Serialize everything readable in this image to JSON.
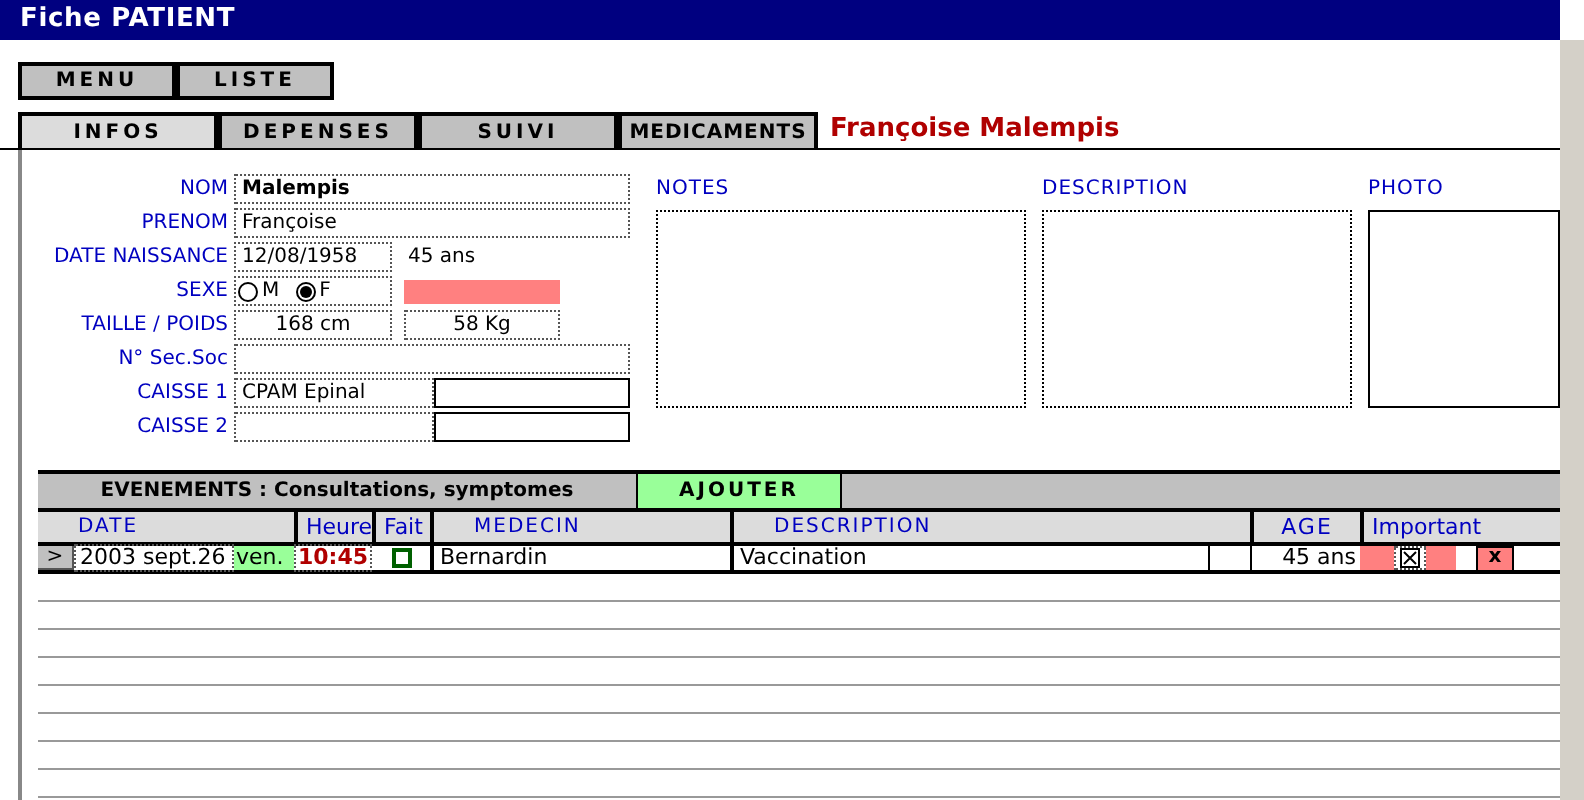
{
  "window": {
    "title": "Fiche PATIENT"
  },
  "nav_buttons": [
    "MENU",
    "LISTE"
  ],
  "tabs": [
    {
      "label": "INFOS",
      "selected": true
    },
    {
      "label": "DEPENSES",
      "selected": false
    },
    {
      "label": "SUIVI",
      "selected": false
    },
    {
      "label": "MEDICAMENTS",
      "selected": false
    }
  ],
  "patient_name": "Françoise Malempis",
  "identity": {
    "nom_label": "NOM",
    "nom": "Malempis",
    "prenom_label": "PRENOM",
    "prenom": "Françoise",
    "birth_label": "DATE NAISSANCE",
    "birth_date": "12/08/1958",
    "age": "45 ans",
    "sex_label": "SEXE",
    "sex_options": [
      {
        "label": "M",
        "selected": false
      },
      {
        "label": "F",
        "selected": true
      }
    ],
    "size_label": "TAILLE / POIDS",
    "height": "168 cm",
    "weight": "58 Kg",
    "ssn_label": "N° Sec.Soc",
    "caisse1_label": "CAISSE 1",
    "caisse1": "CPAM Epinal",
    "caisse2_label": "CAISSE 2"
  },
  "panels": [
    {
      "label": "NOTES",
      "kind": "text"
    },
    {
      "label": "DESCRIPTION",
      "kind": "text"
    },
    {
      "label": "PHOTO",
      "kind": "photo"
    }
  ],
  "events": {
    "title": "EVENEMENTS : Consultations, symptomes",
    "add_button": "AJOUTER",
    "columns": [
      "DATE",
      "Heure",
      "Fait",
      "MEDECIN",
      "DESCRIPTION",
      "AGE",
      "Important"
    ],
    "rows": [
      {
        "open": ">",
        "date": "2003 sept.26",
        "weekday": "ven.",
        "time": "10:45",
        "done": false,
        "medecin": "Bernardin",
        "description": "Vaccination",
        "age": "45 ans",
        "important": true,
        "delete": "x"
      }
    ]
  }
}
